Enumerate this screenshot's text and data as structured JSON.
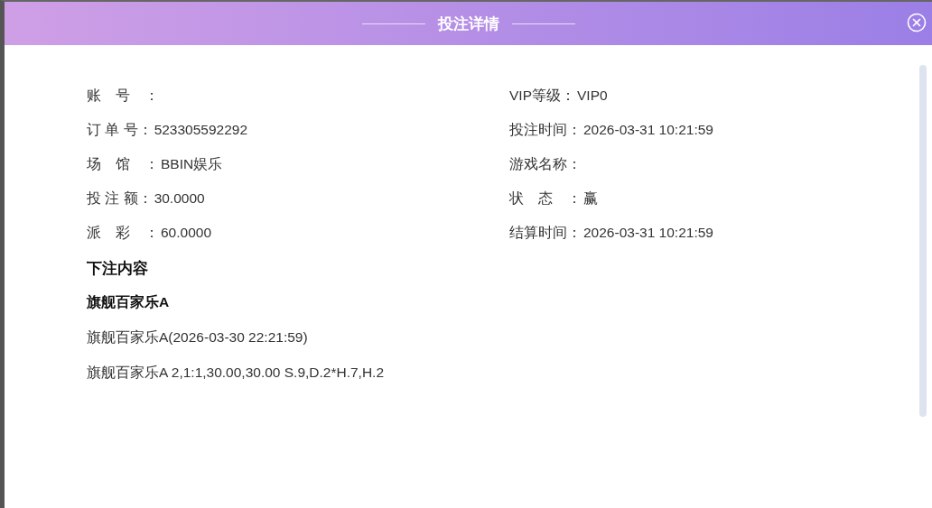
{
  "dialog": {
    "title": "投注详情"
  },
  "left_fields": [
    {
      "label": "账　号　："
    },
    {
      "label": "订 单 号：",
      "value": "523305592292"
    },
    {
      "label": "场　馆　：",
      "value": "BBIN娱乐"
    },
    {
      "label": "投 注 额：",
      "value": "30.0000"
    },
    {
      "label": "派　彩　：",
      "value": "60.0000"
    }
  ],
  "right_fields": [
    {
      "label": "VIP等级：",
      "value": "VIP0"
    },
    {
      "label": "投注时间：",
      "value": "2026-03-31 10:21:59"
    },
    {
      "label": "游戏名称："
    },
    {
      "label": "状　态　：",
      "value": "赢"
    },
    {
      "label": "结算时间：",
      "value": "2026-03-31 10:21:59"
    }
  ],
  "bet_content": {
    "heading": "下注内容",
    "game": "旗舰百家乐A",
    "lines": [
      "旗舰百家乐A(2026-03-30 22:21:59)",
      "旗舰百家乐A 2,1:1,30.00,30.00 S.9,D.2*H.7,H.2"
    ]
  }
}
